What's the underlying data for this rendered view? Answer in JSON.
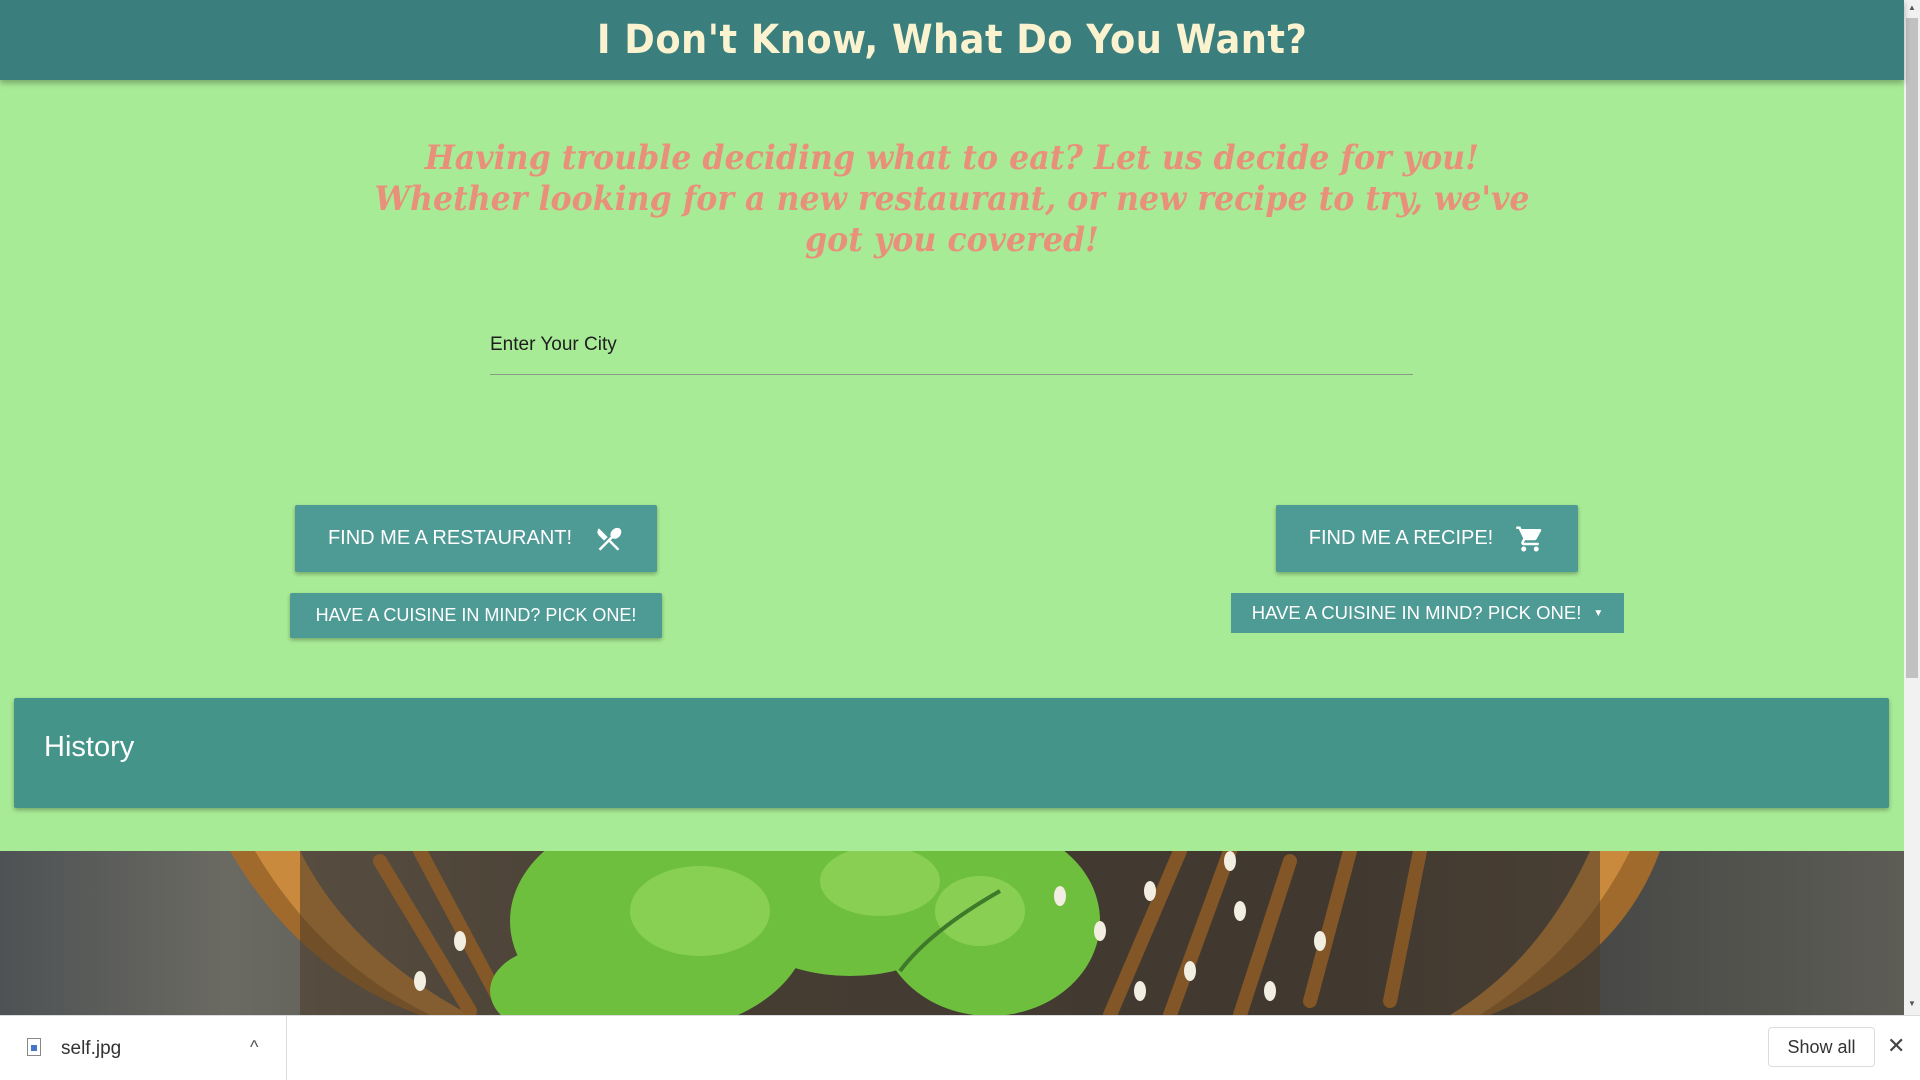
{
  "header": {
    "title": "I Don't Know, What Do You Want?"
  },
  "tagline": "Having trouble deciding what to eat? Let us decide for you! Whether looking for a new restaurant, or new recipe to try, we've got you covered!",
  "city_input": {
    "placeholder": "Enter Your City",
    "value": ""
  },
  "restaurant": {
    "button_label": "FIND ME A RESTAURANT!",
    "icon": "fork-knife-icon",
    "cuisine_button_label": "HAVE A CUISINE IN MIND? PICK ONE!"
  },
  "recipe": {
    "button_label": "FIND ME A RECIPE!",
    "icon": "shopping-cart-icon",
    "cuisine_select_label": "HAVE A CUISINE IN MIND? PICK ONE!",
    "caret": "▼"
  },
  "history": {
    "title": "History"
  },
  "download_bar": {
    "file_name": "self.jpg",
    "chevron": "^",
    "show_all_label": "Show all",
    "close": "✕"
  },
  "colors": {
    "page_background": "#a8eb96",
    "header_background": "#3a7f7d",
    "header_text": "#fbf3d0",
    "tagline_text": "#e8907a",
    "button_background": "#4e9a95",
    "history_background": "#44948a"
  }
}
